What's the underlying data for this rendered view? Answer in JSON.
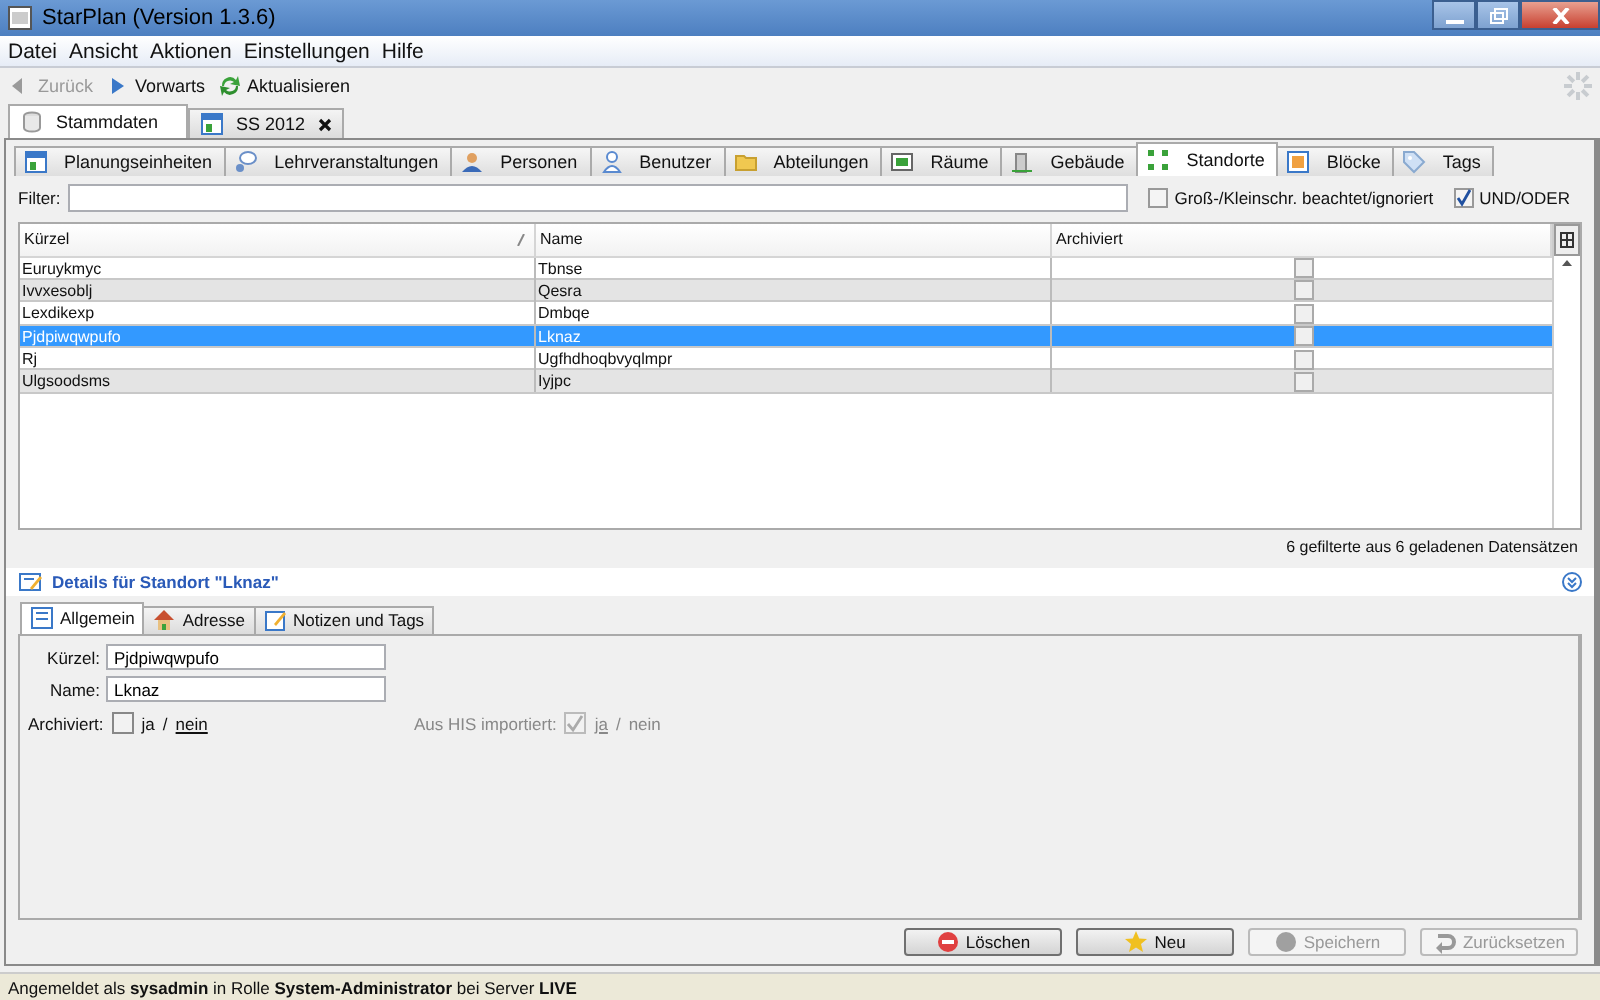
{
  "window": {
    "title": "StarPlan (Version 1.3.6)"
  },
  "menu": [
    {
      "label": "Datei"
    },
    {
      "label": "Ansicht"
    },
    {
      "label": "Aktionen"
    },
    {
      "label": "Einstellungen"
    },
    {
      "label": "Hilfe"
    }
  ],
  "toolbar": [
    {
      "label": "Zurück",
      "kind": "back",
      "disabled": true
    },
    {
      "label": "Vorwarts",
      "kind": "forward",
      "disabled": false
    },
    {
      "label": "Aktualisieren",
      "kind": "refresh",
      "disabled": false
    }
  ],
  "document_tabs": [
    {
      "label": "Stammdaten",
      "kind": "db",
      "selected": true,
      "closable": false
    },
    {
      "label": "SS 2012",
      "kind": "grid",
      "selected": false,
      "closable": true
    }
  ],
  "entity_tabs": [
    {
      "label": "Planungseinheiten",
      "kind": "grid",
      "selected": false
    },
    {
      "label": "Lehrveranstaltungen",
      "kind": "chat",
      "selected": false
    },
    {
      "label": "Personen",
      "kind": "person",
      "selected": false
    },
    {
      "label": "Benutzer",
      "kind": "user",
      "selected": false
    },
    {
      "label": "Abteilungen",
      "kind": "folder",
      "selected": false
    },
    {
      "label": "Räume",
      "kind": "room",
      "selected": false
    },
    {
      "label": "Gebäude",
      "kind": "building",
      "selected": false
    },
    {
      "label": "Standorte",
      "kind": "sites",
      "selected": true
    },
    {
      "label": "Blöcke",
      "kind": "block",
      "selected": false
    },
    {
      "label": "Tags",
      "kind": "tag",
      "selected": false
    }
  ],
  "filter": {
    "label": "Filter:",
    "case_option": {
      "label": "Groß-/Kleinschr. beachtet/ignoriert",
      "checked": false
    },
    "and_or": {
      "label": "UND/ODER",
      "checked": true
    }
  },
  "table": {
    "columns": [
      "Kürzel",
      "Name",
      "Archiviert"
    ],
    "rows": [
      {
        "kuerzel": "Euruykmyc",
        "name": "Tbnse",
        "archived": false,
        "selected": false
      },
      {
        "kuerzel": "Ivvxesoblj",
        "name": "Qesra",
        "archived": false,
        "selected": false
      },
      {
        "kuerzel": "Lexdikexp",
        "name": "Dmbqe",
        "archived": false,
        "selected": false
      },
      {
        "kuerzel": "Pjdpiwqwpufo",
        "name": "Lknaz",
        "archived": false,
        "selected": true
      },
      {
        "kuerzel": "Rj",
        "name": "Ugfhdhoqbvyqlmpr",
        "archived": false,
        "selected": false
      },
      {
        "kuerzel": "Ulgsoodsms",
        "name": "Iyjpc",
        "archived": false,
        "selected": false
      }
    ],
    "count": "6 gefilterte aus 6 geladenen Datensätzen"
  },
  "details": {
    "title": "Details für Standort \"Lknaz\"",
    "tabs": [
      {
        "label": "Allgemein",
        "kind": "form",
        "selected": true
      },
      {
        "label": "Adresse",
        "kind": "house",
        "selected": false
      },
      {
        "label": "Notizen und Tags",
        "kind": "note",
        "selected": false
      }
    ],
    "fields": [
      {
        "label": "Kürzel:",
        "value": "Pjdpiwqwpufo"
      },
      {
        "label": "Name:",
        "value": "Lknaz"
      }
    ],
    "options": [
      {
        "label": "Archiviert:",
        "checked": false,
        "disabled": false,
        "yes": "ja",
        "separator": "/",
        "no": "nein"
      },
      {
        "label": "Aus HIS importiert:",
        "checked": true,
        "disabled": true,
        "yes": "ja",
        "separator": "/",
        "no": "nein"
      }
    ]
  },
  "buttons": [
    {
      "label": "Löschen",
      "kind": "delete",
      "disabled": false
    },
    {
      "label": "Neu",
      "kind": "star",
      "disabled": false
    },
    {
      "label": "Speichern",
      "kind": "save",
      "disabled": true
    },
    {
      "label": "Zurücksetzen",
      "kind": "undo",
      "disabled": true
    }
  ],
  "status_bar": "Angemeldet als **sysadmin** in Rolle **System-Administrator** bei Server **LIVE**"
}
